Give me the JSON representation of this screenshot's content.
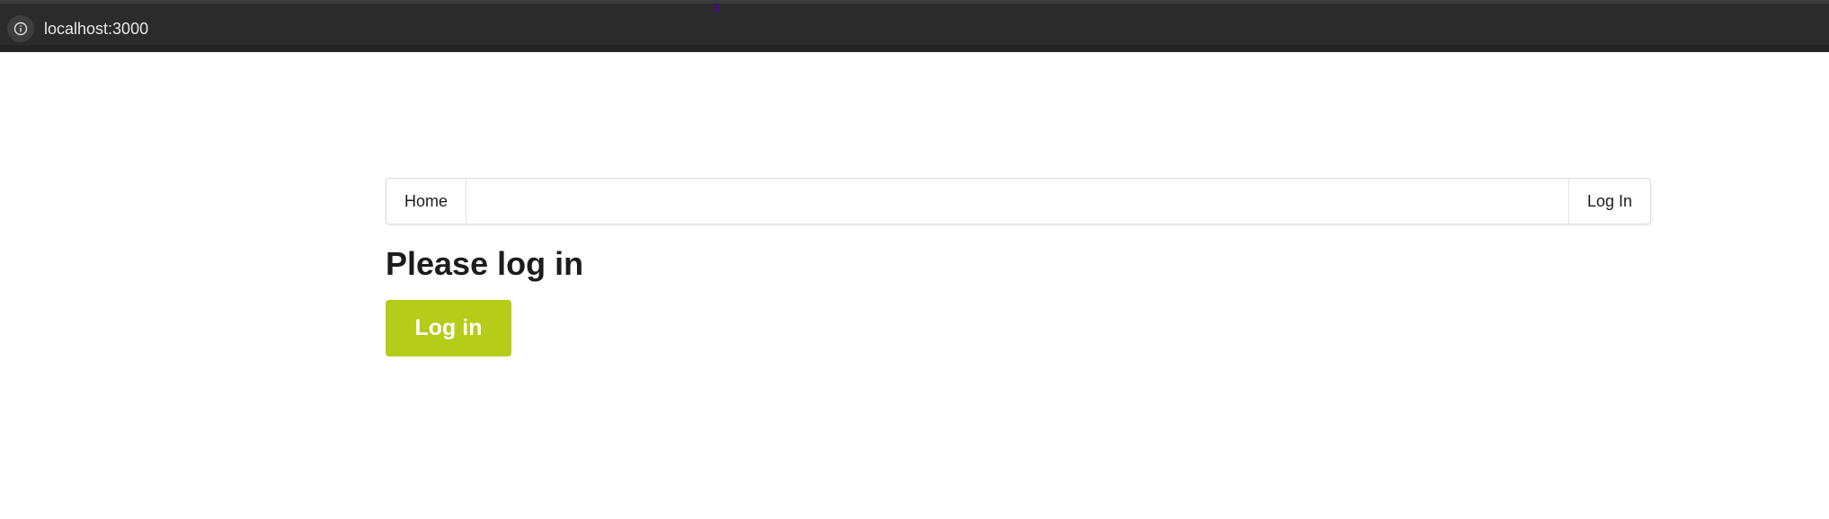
{
  "browser": {
    "url": "localhost:3000",
    "info_icon": "info-icon"
  },
  "navbar": {
    "home_label": "Home",
    "login_label": "Log In"
  },
  "main": {
    "title": "Please log in",
    "login_button_label": "Log in",
    "accent_color": "#b5cc18"
  }
}
